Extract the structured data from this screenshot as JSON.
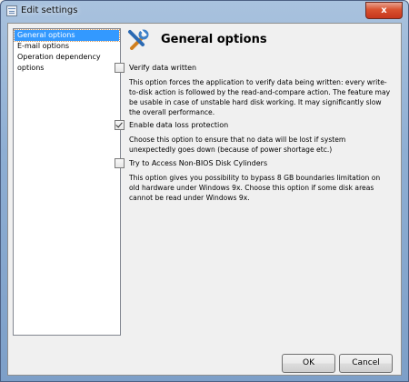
{
  "window": {
    "title": "Edit settings",
    "close": "x"
  },
  "sidebar": {
    "items": [
      {
        "label": "General options",
        "selected": true
      },
      {
        "label": "E-mail options",
        "selected": false
      },
      {
        "label": "Operation dependency options",
        "selected": false
      }
    ]
  },
  "main": {
    "title": "General options",
    "options": [
      {
        "label": "Verify data written",
        "checked": false,
        "description": "This option forces the application to verify data being written: every write-to-disk action is followed by the read-and-compare action. The feature may be usable in case of unstable hard disk working. It may significantly slow the overall performance."
      },
      {
        "label": "Enable data loss protection",
        "checked": true,
        "description": "Choose this option to ensure that no data will be lost if system unexpectedly goes down (because of power shortage etc.)"
      },
      {
        "label": "Try to Access Non-BIOS Disk Cylinders",
        "checked": false,
        "description": "This option gives you possibility to bypass 8 GB boundaries limitation on old hardware under Windows 9x. Choose this option if some disk areas cannot be read under Windows 9x."
      }
    ]
  },
  "buttons": {
    "ok": "OK",
    "cancel": "Cancel"
  },
  "icons": {
    "app": "settings-list-icon",
    "tools": "tools-icon"
  }
}
